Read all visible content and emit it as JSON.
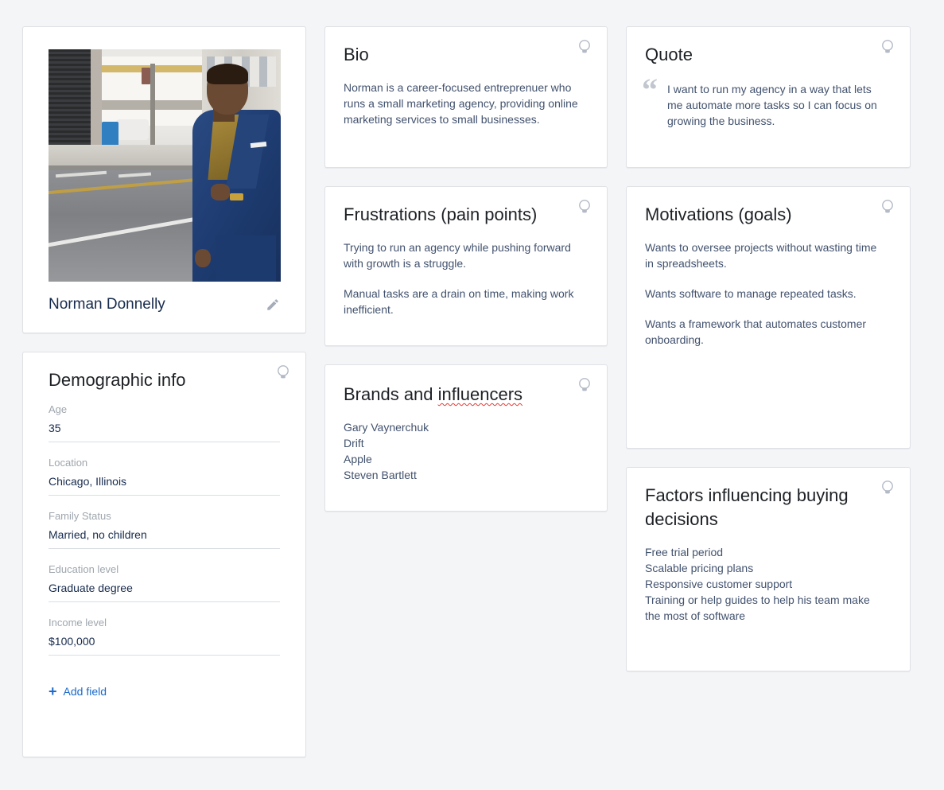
{
  "profile": {
    "name": "Norman Donnelly",
    "edit_icon": "pencil-icon",
    "photo_alt": "Man in blue suit standing on a city street"
  },
  "demographic": {
    "title": "Demographic info",
    "hint_icon": "lightbulb-icon",
    "fields": [
      {
        "label": "Age",
        "value": "35"
      },
      {
        "label": "Location",
        "value": "Chicago, Illinois"
      },
      {
        "label": "Family Status",
        "value": "Married, no children"
      },
      {
        "label": "Education level",
        "value": "Graduate degree"
      },
      {
        "label": "Income level",
        "value": "$100,000"
      }
    ],
    "add_field_label": "Add field",
    "add_field_icon": "plus-icon",
    "link_color": "#1b6ac9"
  },
  "bio": {
    "title": "Bio",
    "hint_icon": "lightbulb-icon",
    "text": "Norman is a career-focused entreprenuer who runs a small marketing agency, providing online marketing services to small businesses."
  },
  "frustrations": {
    "title": "Frustrations (pain points)",
    "hint_icon": "lightbulb-icon",
    "paragraphs": [
      "Trying to run an agency while pushing forward with growth is a struggle.",
      "Manual tasks are a drain on time, making work inefficient."
    ]
  },
  "brands": {
    "title_part1": "Brands and ",
    "title_misspelled": "influencers",
    "hint_icon": "lightbulb-icon",
    "spellcheck_color": "#e53935",
    "items": [
      "Gary Vaynerchuk",
      "Drift",
      "Apple",
      "Steven Bartlett"
    ]
  },
  "quote": {
    "title": "Quote",
    "hint_icon": "lightbulb-icon",
    "quote_mark": "“",
    "text": "I want to run my agency in a way that lets me automate more tasks so I can focus on growing the business."
  },
  "motivations": {
    "title": "Motivations (goals)",
    "hint_icon": "lightbulb-icon",
    "paragraphs": [
      "Wants to oversee projects without wasting time in spreadsheets.",
      "Wants software to manage repeated tasks.",
      "Wants a framework that automates customer onboarding."
    ]
  },
  "factors": {
    "title": "Factors influencing buying decisions",
    "hint_icon": "lightbulb-icon",
    "items": [
      "Free trial period",
      "Scalable pricing plans",
      "Responsive customer support",
      "Training or help guides to help his team make the most of software"
    ]
  },
  "theme": {
    "page_background": "#f4f5f7",
    "card_background": "#ffffff",
    "card_border": "#dfe1e6",
    "heading_color": "#1d2125",
    "body_text_color": "#42526e",
    "label_color": "#9fa6ae",
    "icon_color": "#a5adba"
  }
}
